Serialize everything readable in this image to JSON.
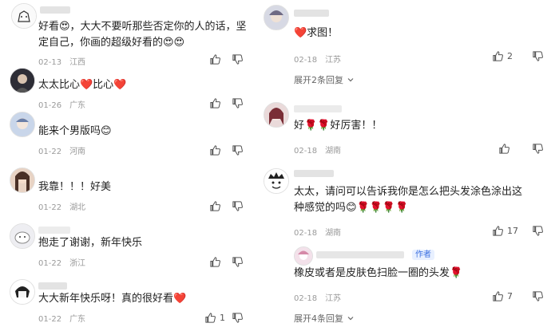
{
  "left_comments": [
    {
      "text_line1": "好看😍，大大不要听那些否定你的人的话，坚",
      "text_line2": "定自己，你画的超级好看的😍😍",
      "date": "02-13",
      "location": "江西",
      "likes": ""
    },
    {
      "text": "太太比心❤️比心❤️",
      "date": "01-26",
      "location": "广东",
      "likes": ""
    },
    {
      "text": "能来个男版吗😊",
      "date": "01-22",
      "location": "河南",
      "likes": ""
    },
    {
      "text": "我靠！！！好美",
      "date": "01-22",
      "location": "湖北",
      "likes": ""
    },
    {
      "text": "抱走了谢谢，新年快乐",
      "date": "01-22",
      "location": "浙江",
      "likes": ""
    },
    {
      "text": "大大新年快乐呀！真的很好看❤️",
      "date": "01-22",
      "location": "广东",
      "likes": "1"
    }
  ],
  "right_comments": [
    {
      "text": "❤️求图！",
      "date": "02-18",
      "location": "江苏",
      "likes": "2",
      "expand": "展开2条回复"
    },
    {
      "text": "好🌹🌹好厉害！！",
      "date": "02-18",
      "location": "湖南",
      "likes": ""
    },
    {
      "text_line1": "太太，请问可以告诉我你是怎么把头发涂色涂出这",
      "text_line2": "种感觉的吗😊🌹🌹🌹🌹",
      "date": "02-18",
      "location": "湖南",
      "likes": "17"
    },
    {
      "badge": "作者",
      "text": "橡皮或者是皮肤色扫脸一圈的头发🌹",
      "date": "02-18",
      "location": "江苏",
      "likes": "7",
      "expand": "展开4条回复"
    }
  ],
  "colors": {
    "heart": "#e8333a",
    "meta": "#9a9a9a",
    "badge_bg": "#e8f0ff",
    "badge_fg": "#3b6fe0",
    "rose": "#d9363e"
  }
}
